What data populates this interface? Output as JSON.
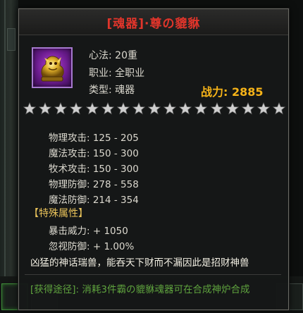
{
  "item": {
    "title": "[魂器]·尊の貔貅",
    "info": [
      "心法: 20重",
      "职业: 全职业",
      "类型: 魂器"
    ],
    "power_label": "战力: 2885",
    "star_count": 17,
    "star_color": "#cfcfcf"
  },
  "stats": [
    "物理攻击: 125 - 205",
    "魔法攻击: 150 - 300",
    "牧术攻击: 150 - 300",
    "物理防御: 278 - 558",
    "魔法防御: 214 - 354"
  ],
  "special": {
    "header": "【特殊属性】",
    "lines": [
      "暴击威力: + 1050",
      "忽视防御: + 1.00%"
    ]
  },
  "description": "凶猛的神话瑞兽，能吞天下财而不漏因此是招财神兽",
  "source": "[获得途径]: 消耗3件霸の貔貅魂器可在合成神炉合成",
  "colors": {
    "title": "#e0352b",
    "power": "#f6b318",
    "section_header": "#e8c25a",
    "source": "#5fa33e",
    "icon_frame": "#a77ad0"
  }
}
